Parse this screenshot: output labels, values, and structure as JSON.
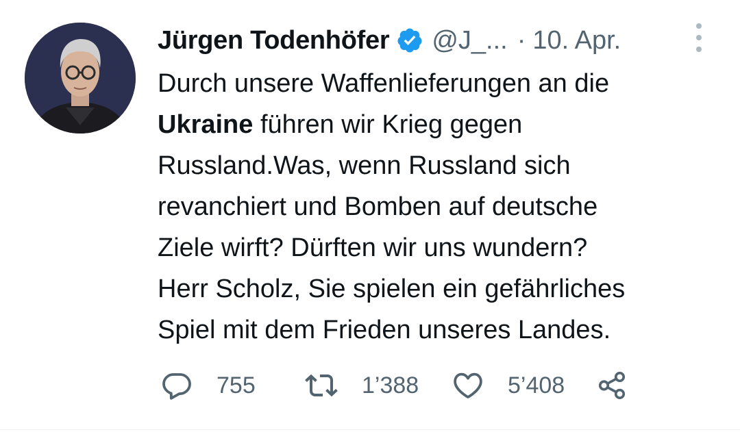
{
  "author": {
    "name": "Jürgen Todenhöfer",
    "handle": "@J_...",
    "separator": "·",
    "date": "10. Apr.",
    "verified": true
  },
  "tweet": {
    "line1": "Durch unsere Waffenlieferungen an die",
    "line2_bold": "Ukraine",
    "line2_rest": " führen wir Krieg gegen",
    "line3": "Russland.Was, wenn Russland sich",
    "line4": "revanchiert und Bomben auf deutsche",
    "line5": "Ziele wirft? Dürften wir uns wundern?",
    "line6": "Herr Scholz, Sie spielen ein gefährliches",
    "line7": "Spiel mit dem Frieden unseres Landes."
  },
  "actions": {
    "replies": "755",
    "retweets": "1’388",
    "likes": "5’408"
  },
  "icons": {
    "reply": "speech-bubble-icon",
    "retweet": "retweet-arrows-icon",
    "like": "heart-icon",
    "share": "share-icon",
    "verified": "verified-badge-icon",
    "more": "more-options-icon"
  },
  "colors": {
    "text": "#0f1419",
    "muted": "#536471",
    "verified": "#1d9bf0"
  }
}
